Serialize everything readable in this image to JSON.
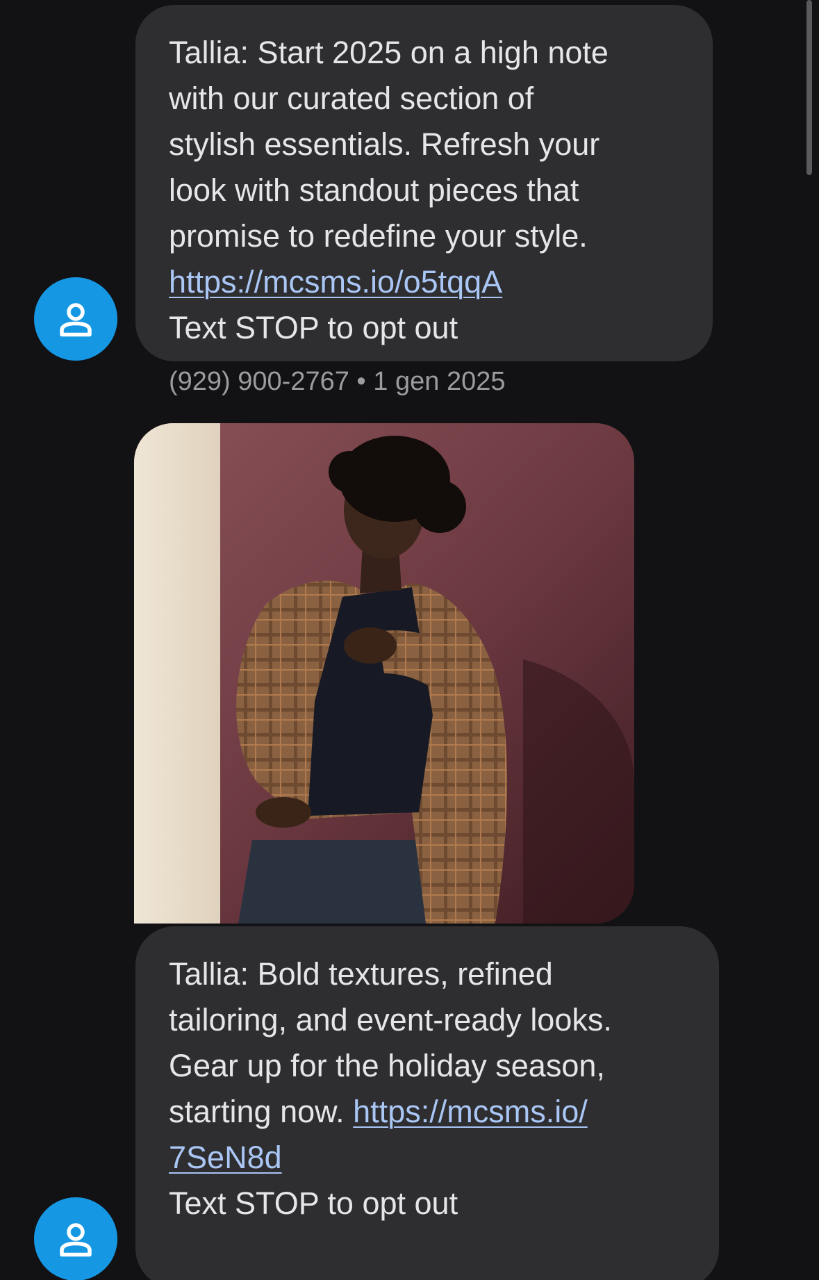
{
  "messages": [
    {
      "lines": [
        "Tallia: Start 2025 on a high note",
        "with our curated section of",
        "stylish essentials. Refresh your",
        "look with standout pieces that",
        "promise to redefine your style."
      ],
      "link": "https://mcsms.io/o5tqqA",
      "footer": "Text STOP to opt out",
      "sender": "(929) 900-2767",
      "separator": "•",
      "date": "1 gen 2025"
    },
    {
      "lines": [
        "Tallia: Bold textures, refined",
        "tailoring, and event-ready looks.",
        "Gear up for the holiday season,"
      ],
      "line4_prefix": "starting now. ",
      "link_part1": "https://mcsms.io/",
      "link_part2": "7SeN8d",
      "footer": "Text STOP to opt out"
    }
  ],
  "avatar_icon": "person-icon",
  "colors": {
    "background": "#121214",
    "bubble": "#2e2e30",
    "link": "#a9c6f5",
    "avatar": "#1597e3",
    "meta_text": "#9b9ba0"
  }
}
